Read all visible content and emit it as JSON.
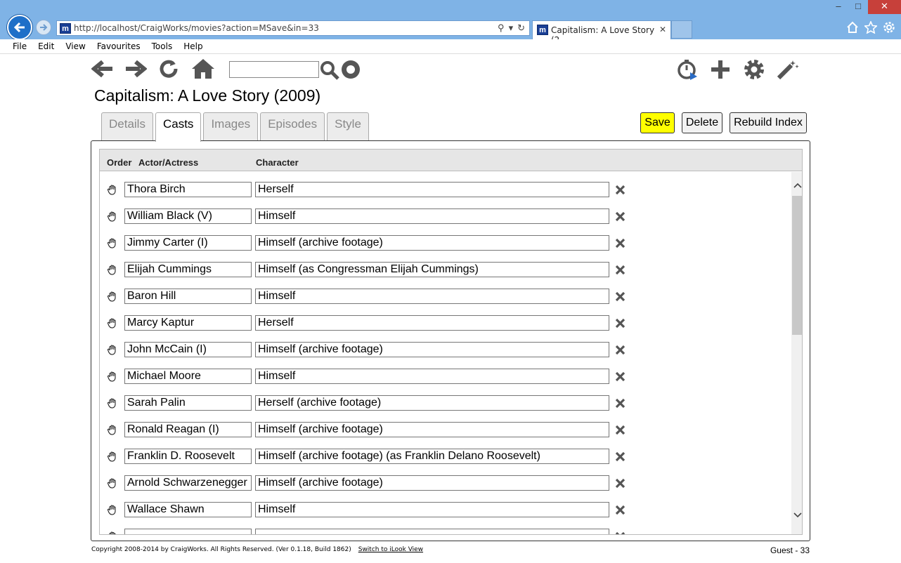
{
  "browser": {
    "url": "http://localhost/CraigWorks/movies?action=MSave&in=33",
    "tab_title": "Capitalism: A Love Story (2...",
    "favicon_letter": "m",
    "menu": [
      "File",
      "Edit",
      "View",
      "Favourites",
      "Tools",
      "Help"
    ]
  },
  "page": {
    "title": "Capitalism: A Love Story (2009)",
    "search_value": "",
    "tabs": [
      {
        "label": "Details",
        "active": false
      },
      {
        "label": "Casts",
        "active": true
      },
      {
        "label": "Images",
        "active": false
      },
      {
        "label": "Episodes",
        "active": false
      },
      {
        "label": "Style",
        "active": false
      }
    ],
    "buttons": {
      "save": "Save",
      "delete": "Delete",
      "rebuild": "Rebuild Index"
    },
    "save_color": "#ffff00"
  },
  "cast_table": {
    "headers": {
      "order": "Order",
      "actor": "Actor/Actress",
      "character": "Character"
    },
    "rows": [
      {
        "actor": "Thora Birch",
        "character": "Herself"
      },
      {
        "actor": "William Black (V)",
        "character": "Himself"
      },
      {
        "actor": "Jimmy Carter (I)",
        "character": "Himself (archive footage)"
      },
      {
        "actor": "Elijah Cummings",
        "character": "Himself (as Congressman Elijah Cummings)"
      },
      {
        "actor": "Baron Hill",
        "character": "Himself"
      },
      {
        "actor": "Marcy Kaptur",
        "character": "Herself"
      },
      {
        "actor": "John McCain (I)",
        "character": "Himself (archive footage)"
      },
      {
        "actor": "Michael Moore",
        "character": "Himself"
      },
      {
        "actor": "Sarah Palin",
        "character": "Herself (archive footage)"
      },
      {
        "actor": "Ronald Reagan (I)",
        "character": "Himself (archive footage)"
      },
      {
        "actor": "Franklin D. Roosevelt",
        "character": "Himself (archive footage) (as Franklin Delano Roosevelt)"
      },
      {
        "actor": "Arnold Schwarzenegger",
        "character": "Himself (archive footage)"
      },
      {
        "actor": "Wallace Shawn",
        "character": "Himself"
      },
      {
        "actor": "",
        "character": ""
      }
    ]
  },
  "footer": {
    "copyright": "Copyright 2008-2014 by CraigWorks. All Rights Reserved. (Ver 0.1.18, Build 1862)",
    "switch_link": "Switch to iLook View",
    "user": "Guest - 33"
  }
}
